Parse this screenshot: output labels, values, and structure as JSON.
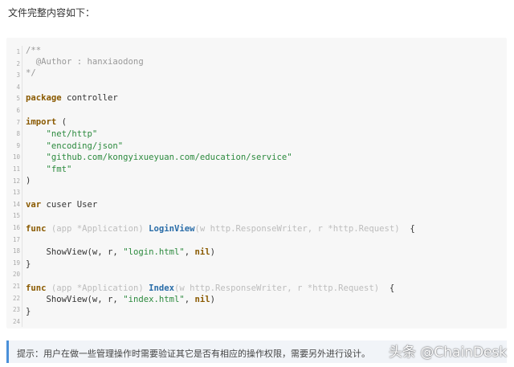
{
  "intro_text": "文件完整内容如下：",
  "code": {
    "line_numbers": [
      "1",
      "2",
      "3",
      "4",
      "5",
      "6",
      "7",
      "8",
      "9",
      "10",
      "11",
      "12",
      "13",
      "14",
      "15",
      "16",
      "17",
      "18",
      "19",
      "20",
      "21",
      "22",
      "23",
      "24"
    ],
    "lines": {
      "l1": "/**",
      "l2": "  @Author : hanxiaodong",
      "l3": "*/",
      "l5_kw": "package",
      "l5_rest": " controller",
      "l7_kw": "import",
      "l7_rest": " (",
      "l8": "    \"net/http\"",
      "l9": "    \"encoding/json\"",
      "l10": "    \"github.com/kongyixueyuan.com/education/service\"",
      "l11": "    \"fmt\"",
      "l12": ")",
      "l14_kw": "var",
      "l14_rest": " cuser User",
      "l16_kw": "func",
      "l16_recv": " (app *Application) ",
      "l16_fn": "LoginView",
      "l16_params": "(w http.ResponseWriter, r *http.Request)",
      "l16_tail": "  {",
      "l18_pre": "    ShowView(w, r, ",
      "l18_str": "\"login.html\"",
      "l18_mid": ", ",
      "l18_nil": "nil",
      "l18_end": ")",
      "l19": "}",
      "l21_kw": "func",
      "l21_recv": " (app *Application) ",
      "l21_fn": "Index",
      "l21_params": "(w http.ResponseWriter, r *http.Request)",
      "l21_tail": "  {",
      "l22_pre": "    ShowView(w, r, ",
      "l22_str": "\"index.html\"",
      "l22_mid": ", ",
      "l22_nil": "nil",
      "l22_end": ")",
      "l23": "}"
    }
  },
  "tip_text": "提示：用户在做一些管理操作时需要验证其它是否有相应的操作权限，需要另外进行设计。",
  "watermark": "头条 @ChainDesk"
}
